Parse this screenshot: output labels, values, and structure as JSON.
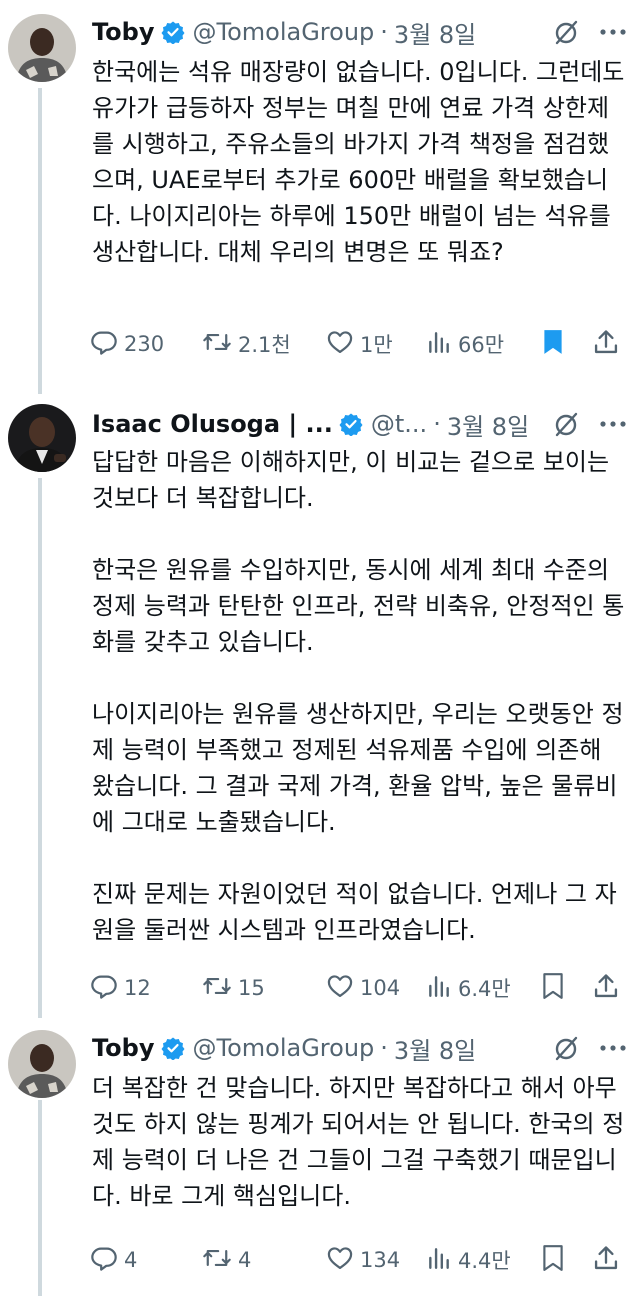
{
  "tweets": [
    {
      "name": "Toby",
      "handle": "@TomolaGroup",
      "date": "3월 8일",
      "text": "한국에는 석유 매장량이 없습니다. 0입니다. 그런데도 유가가 급등하자 정부는 며칠 만에 연료 가격 상한제를 시행하고, 주유소들의 바가지 가격 책정을 점검했으며, UAE로부터 추가로 600만 배럴을 확보했습니다. 나이지리아는 하루에 150만 배럴이 넘는 석유를 생산합니다. 대체 우리의 변명은 또 뭐죠?",
      "replies": "230",
      "retweets": "2.1천",
      "likes": "1만",
      "views": "66만",
      "bookmarked": true
    },
    {
      "name": "Isaac Olusoga | ...",
      "handle": "@t...",
      "date": "3월 8일",
      "text": "답답한 마음은 이해하지만, 이 비교는 겉으로 보이는 것보다 더 복잡합니다.\n\n한국은 원유를 수입하지만, 동시에 세계 최대 수준의 정제 능력과 탄탄한 인프라, 전략 비축유, 안정적인 통화를 갖추고 있습니다.\n\n나이지리아는 원유를 생산하지만, 우리는 오랫동안 정제 능력이 부족했고 정제된 석유제품 수입에 의존해 왔습니다. 그 결과 국제 가격, 환율 압박, 높은 물류비에 그대로 노출됐습니다.\n\n진짜 문제는 자원이었던 적이 없습니다. 언제나 그 자원을 둘러싼 시스템과 인프라였습니다.",
      "replies": "12",
      "retweets": "15",
      "likes": "104",
      "views": "6.4만",
      "bookmarked": false
    },
    {
      "name": "Toby",
      "handle": "@TomolaGroup",
      "date": "3월 8일",
      "text": "더 복잡한 건 맞습니다. 하지만 복잡하다고 해서 아무것도 하지 않는 핑계가 되어서는 안 됩니다. 한국의 정제 능력이 더 나은 건 그들이 그걸 구축했기 때문입니다. 바로 그게 핵심입니다.",
      "replies": "4",
      "retweets": "4",
      "likes": "134",
      "views": "4.4만",
      "bookmarked": false
    }
  ],
  "icons": {
    "verified": "verified-badge-icon",
    "grok": "slashed-circle-icon",
    "more": "more-icon",
    "reply": "reply-icon",
    "retweet": "retweet-icon",
    "like": "heart-icon",
    "views": "views-icon",
    "bookmark": "bookmark-icon",
    "share": "share-icon"
  },
  "colors": {
    "accent": "#1d9bf0",
    "muted": "#536471",
    "text": "#0f1419",
    "thread_line": "#cfd9de"
  }
}
